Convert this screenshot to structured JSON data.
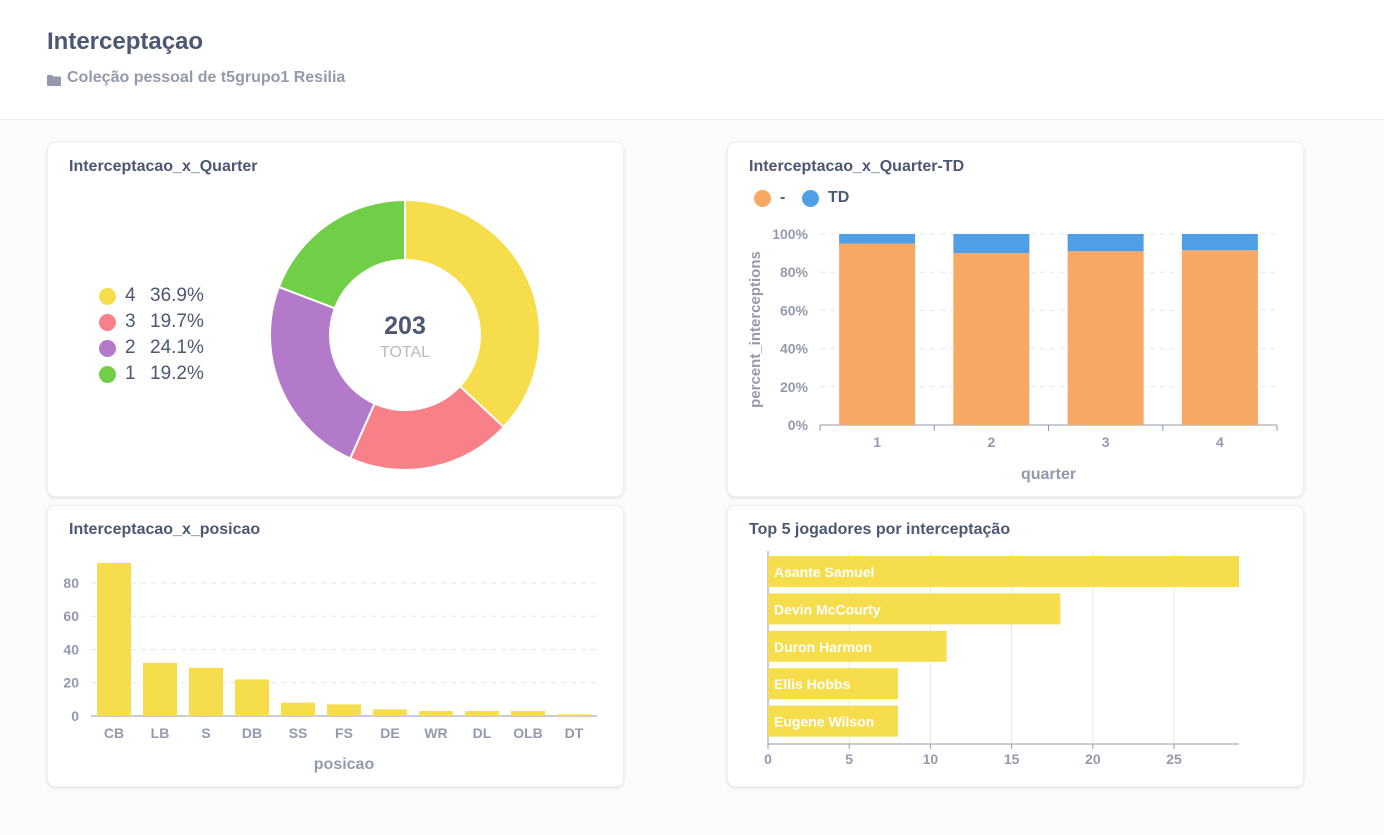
{
  "page": {
    "title": "Interceptaçao",
    "collection": "Coleção pessoal de t5grupo1 Resilia"
  },
  "icons": {
    "collection": "folder-icon"
  },
  "cards": {
    "quarter": {
      "title": "Interceptacao_x_Quarter",
      "total_value": "203",
      "total_label": "TOTAL",
      "legend": [
        {
          "key": "4",
          "pct": "36.9%",
          "color": "#f5dd4c"
        },
        {
          "key": "3",
          "pct": "19.7%",
          "color": "#f88189"
        },
        {
          "key": "2",
          "pct": "24.1%",
          "color": "#b27ac9"
        },
        {
          "key": "1",
          "pct": "19.2%",
          "color": "#70cf46"
        }
      ]
    },
    "quarter_td": {
      "title": "Interceptacao_x_Quarter-TD",
      "legend": [
        {
          "label": "-",
          "color": "#f7a864"
        },
        {
          "label": "TD",
          "color": "#509ee3"
        }
      ]
    },
    "posicao": {
      "title": "Interceptacao_x_posicao"
    },
    "top5": {
      "title": "Top 5 jogadores por interceptação"
    }
  },
  "chart_data": [
    {
      "type": "pie",
      "categories": [
        "4",
        "3",
        "2",
        "1"
      ],
      "values": [
        75,
        40,
        49,
        39
      ],
      "percentages": [
        36.9,
        19.7,
        24.1,
        19.2
      ],
      "colors": [
        "#f5dd4c",
        "#f88189",
        "#b27ac9",
        "#70cf46"
      ],
      "total": 203
    },
    {
      "type": "bar",
      "stacked": true,
      "categories": [
        "1",
        "2",
        "3",
        "4"
      ],
      "series": [
        {
          "name": "-",
          "values": [
            95,
            90,
            91,
            91.5
          ],
          "color": "#f7a864"
        },
        {
          "name": "TD",
          "values": [
            5,
            10,
            9,
            8.5
          ],
          "color": "#509ee3"
        }
      ],
      "xlabel": "quarter",
      "ylabel": "percent_interceptions",
      "yticks": [
        "0%",
        "20%",
        "40%",
        "60%",
        "80%",
        "100%"
      ],
      "ylim": [
        0,
        100
      ]
    },
    {
      "type": "bar",
      "categories": [
        "CB",
        "LB",
        "S",
        "DB",
        "SS",
        "FS",
        "DE",
        "WR",
        "DL",
        "OLB",
        "DT"
      ],
      "values": [
        92,
        32,
        29,
        22,
        8,
        7,
        4,
        3,
        3,
        3,
        1
      ],
      "color": "#f5dd4c",
      "xlabel": "posicao",
      "yticks": [
        "0",
        "20",
        "40",
        "60",
        "80"
      ],
      "ylim": [
        0,
        92
      ]
    },
    {
      "type": "bar",
      "orientation": "horizontal",
      "categories": [
        "Asante Samuel",
        "Devin McCourty",
        "Duron Harmon",
        "Ellis Hobbs",
        "Eugene Wilson"
      ],
      "values": [
        29,
        18,
        11,
        8,
        8
      ],
      "color": "#f5dd4c",
      "xticks": [
        "0",
        "5",
        "10",
        "15",
        "20",
        "25"
      ],
      "xlim": [
        0,
        29
      ]
    }
  ]
}
